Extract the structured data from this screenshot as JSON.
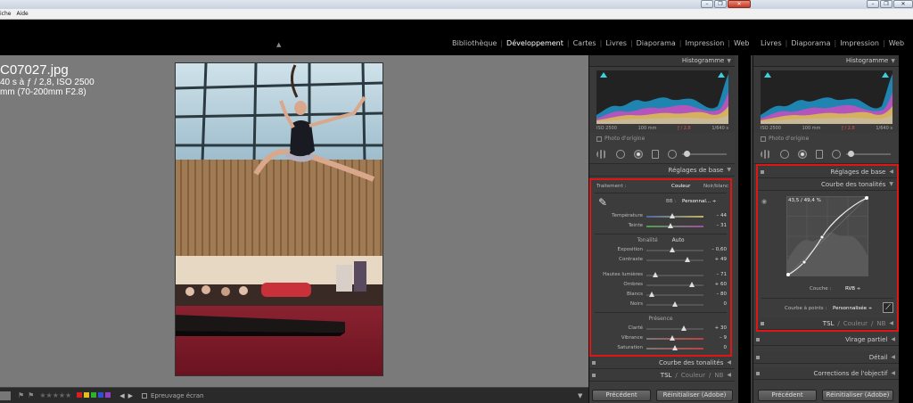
{
  "window": {
    "menu": [
      "iche",
      "Aide"
    ],
    "min": "–",
    "max": "❐",
    "close": "✕"
  },
  "modules": {
    "left": [
      "Bibliothèque",
      "Développement",
      "Cartes",
      "Livres",
      "Diaporama",
      "Impression",
      "Web"
    ],
    "right": [
      "Livres",
      "Diaporama",
      "Impression",
      "Web"
    ],
    "active": "Développement"
  },
  "photo_info": {
    "filename": "C07027.jpg",
    "exposure": "40 s à ƒ / 2,8, ISO 2500",
    "lens": "mm (70-200mm F2.8)"
  },
  "histogram": {
    "title": "Histogramme",
    "exif": [
      "ISO 2500",
      "100 mm",
      "ƒ / 2,8",
      "1/640 s"
    ],
    "original_photo": "Photo d'origine"
  },
  "panel_left": {
    "basic_title": "Réglages de base",
    "treatment_label": "Traitement :",
    "treatment_color": "Couleur",
    "treatment_bw": "Noir/blanc",
    "wb_label": "BB :",
    "wb_value": "Personnal... ÷",
    "temperature": {
      "label": "Température",
      "value": "– 44",
      "pos": 0.46
    },
    "tint": {
      "label": "Teinte",
      "value": "– 31",
      "pos": 0.42
    },
    "tone_label": "Tonalité",
    "auto": "Auto",
    "exposure": {
      "label": "Exposition",
      "value": "– 0,60",
      "pos": 0.45
    },
    "contrast": {
      "label": "Contraste",
      "value": "+ 49",
      "pos": 0.72
    },
    "highlights": {
      "label": "Hautes lumières",
      "value": "– 71",
      "pos": 0.15
    },
    "shadows": {
      "label": "Ombres",
      "value": "+ 60",
      "pos": 0.8
    },
    "whites": {
      "label": "Blancs",
      "value": "– 80",
      "pos": 0.1
    },
    "blacks": {
      "label": "Noirs",
      "value": "0",
      "pos": 0.5
    },
    "presence_label": "Présence",
    "clarity": {
      "label": "Clarté",
      "value": "+ 30",
      "pos": 0.65
    },
    "vibrance": {
      "label": "Vibrance",
      "value": "– 9",
      "pos": 0.46
    },
    "saturation": {
      "label": "Saturation",
      "value": "0",
      "pos": 0.5
    },
    "curve_title": "Courbe des tonalités",
    "hsl": "TSL",
    "color": "Couleur",
    "nb": "NB",
    "previous": "Précédent",
    "reset": "Réinitialiser (Adobe)"
  },
  "panel_right": {
    "basic_title": "Réglages de base",
    "curve_title": "Courbe des tonalités",
    "readout": "43,5 / 49,4 %",
    "channel_label": "Couche :",
    "channel_value": "RVB ÷",
    "points_label": "Courbe à points :",
    "points_value": "Personnalisée ÷",
    "hsl": "TSL",
    "color": "Couleur",
    "nb": "NB",
    "split": "Virage partiel",
    "detail": "Détail",
    "lens": "Corrections de l'objectif",
    "previous": "Précédent",
    "reset": "Réinitialiser (Adobe)"
  },
  "bottom": {
    "stars": "★★★★★",
    "softproof": "Epreuvage écran",
    "label_colors": [
      "#d62020",
      "#e0c020",
      "#30b030",
      "#3050d0",
      "#9040c0"
    ]
  }
}
